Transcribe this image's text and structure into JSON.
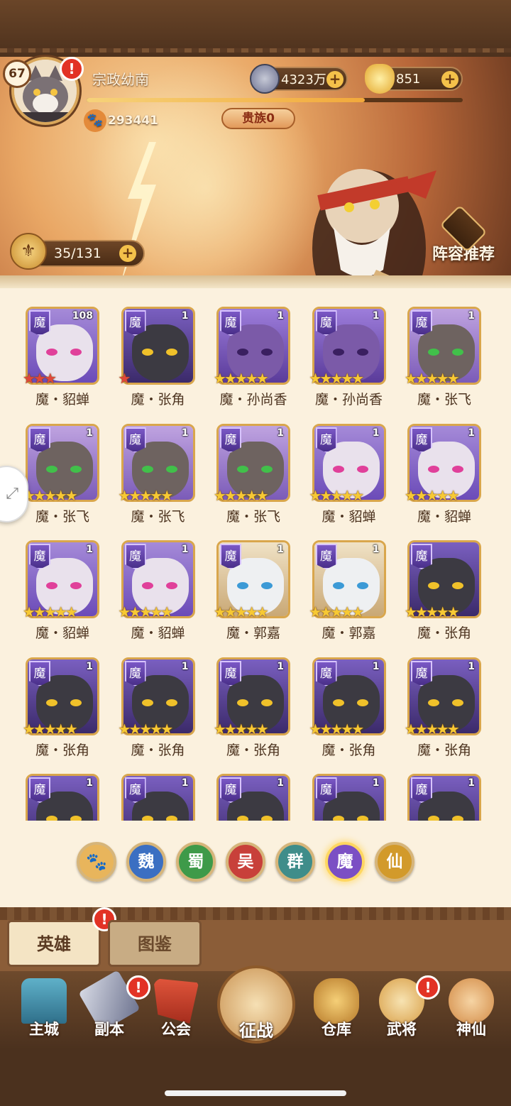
{
  "player": {
    "level": "67",
    "name": "宗政幼南",
    "paw_points": "293441",
    "noble": "贵族0",
    "exp_fraction": 0.74
  },
  "resources": {
    "coins": "4323万",
    "gold": "851"
  },
  "banner": {
    "hero_count": "35/131",
    "word": "英雄",
    "lineup_label": "阵容推荐"
  },
  "heroes": [
    {
      "faction": "魔",
      "level": "108",
      "stars": 3,
      "star_color": "red",
      "name": "魔・貂蝉",
      "kind": "diaochan"
    },
    {
      "faction": "魔",
      "level": "1",
      "stars": 1,
      "star_color": "red",
      "name": "魔・张角",
      "kind": "zhangjiao"
    },
    {
      "faction": "魔",
      "level": "1",
      "stars": 5,
      "star_color": "gold",
      "name": "魔・孙尚香",
      "kind": "sunshangxiang"
    },
    {
      "faction": "魔",
      "level": "1",
      "stars": 5,
      "star_color": "gold",
      "name": "魔・孙尚香",
      "kind": "sunshangxiang"
    },
    {
      "faction": "魔",
      "level": "1",
      "stars": 5,
      "star_color": "gold",
      "name": "魔・张飞",
      "kind": "zhangfei"
    },
    {
      "faction": "魔",
      "level": "1",
      "stars": 5,
      "star_color": "gold",
      "name": "魔・张飞",
      "kind": "zhangfei"
    },
    {
      "faction": "魔",
      "level": "1",
      "stars": 5,
      "star_color": "gold",
      "name": "魔・张飞",
      "kind": "zhangfei"
    },
    {
      "faction": "魔",
      "level": "1",
      "stars": 5,
      "star_color": "gold",
      "name": "魔・张飞",
      "kind": "zhangfei"
    },
    {
      "faction": "魔",
      "level": "1",
      "stars": 5,
      "star_color": "gold",
      "name": "魔・貂蝉",
      "kind": "diaochan"
    },
    {
      "faction": "魔",
      "level": "1",
      "stars": 5,
      "star_color": "gold",
      "name": "魔・貂蝉",
      "kind": "diaochan"
    },
    {
      "faction": "魔",
      "level": "1",
      "stars": 5,
      "star_color": "gold",
      "name": "魔・貂蝉",
      "kind": "diaochan"
    },
    {
      "faction": "魔",
      "level": "1",
      "stars": 5,
      "star_color": "gold",
      "name": "魔・貂蝉",
      "kind": "diaochan"
    },
    {
      "faction": "魔",
      "level": "1",
      "stars": 5,
      "star_color": "gold",
      "name": "魔・郭嘉",
      "kind": "guojia"
    },
    {
      "faction": "魔",
      "level": "1",
      "stars": 5,
      "star_color": "gold",
      "name": "魔・郭嘉",
      "kind": "guojia"
    },
    {
      "faction": "魔",
      "level": "",
      "stars": 5,
      "star_color": "gold",
      "name": "魔・张角",
      "kind": "zhangjiao"
    },
    {
      "faction": "魔",
      "level": "1",
      "stars": 5,
      "star_color": "gold",
      "name": "魔・张角",
      "kind": "zhangjiao"
    },
    {
      "faction": "魔",
      "level": "1",
      "stars": 5,
      "star_color": "gold",
      "name": "魔・张角",
      "kind": "zhangjiao"
    },
    {
      "faction": "魔",
      "level": "1",
      "stars": 5,
      "star_color": "gold",
      "name": "魔・张角",
      "kind": "zhangjiao"
    },
    {
      "faction": "魔",
      "level": "1",
      "stars": 5,
      "star_color": "gold",
      "name": "魔・张角",
      "kind": "zhangjiao"
    },
    {
      "faction": "魔",
      "level": "1",
      "stars": 5,
      "star_color": "gold",
      "name": "魔・张角",
      "kind": "zhangjiao"
    },
    {
      "faction": "魔",
      "level": "1",
      "stars": 0,
      "star_color": "gold",
      "name": "",
      "kind": "zhangjiao"
    },
    {
      "faction": "魔",
      "level": "1",
      "stars": 0,
      "star_color": "gold",
      "name": "",
      "kind": "zhangjiao"
    },
    {
      "faction": "魔",
      "level": "1",
      "stars": 0,
      "star_color": "gold",
      "name": "",
      "kind": "zhangjiao"
    },
    {
      "faction": "魔",
      "level": "1",
      "stars": 0,
      "star_color": "gold",
      "name": "",
      "kind": "zhangjiao"
    },
    {
      "faction": "魔",
      "level": "1",
      "stars": 0,
      "star_color": "gold",
      "name": "",
      "kind": "zhangjiao"
    }
  ],
  "filters": [
    {
      "label": "",
      "icon": "paw-icon",
      "color": "#e8b55c"
    },
    {
      "label": "魏",
      "color": "#3b6fc2"
    },
    {
      "label": "蜀",
      "color": "#3e9a49"
    },
    {
      "label": "吴",
      "color": "#c8403a"
    },
    {
      "label": "群",
      "color": "#3f8d8a"
    },
    {
      "label": "魔",
      "color": "#7b4fc4",
      "selected": true
    },
    {
      "label": "仙",
      "color": "#d29a2b"
    }
  ],
  "tabs": {
    "heroes": "英雄",
    "codex": "图鉴"
  },
  "nav": {
    "main_city": "主城",
    "dungeon": "副本",
    "guild": "公会",
    "campaign": "征战",
    "warehouse": "仓库",
    "generals": "武将",
    "immortals": "神仙"
  },
  "colors": {
    "accent_gold": "#f4c14a",
    "alert_red": "#e23225",
    "panel_bg": "#fbf1de",
    "faction_purple": "#6b4bb8"
  }
}
